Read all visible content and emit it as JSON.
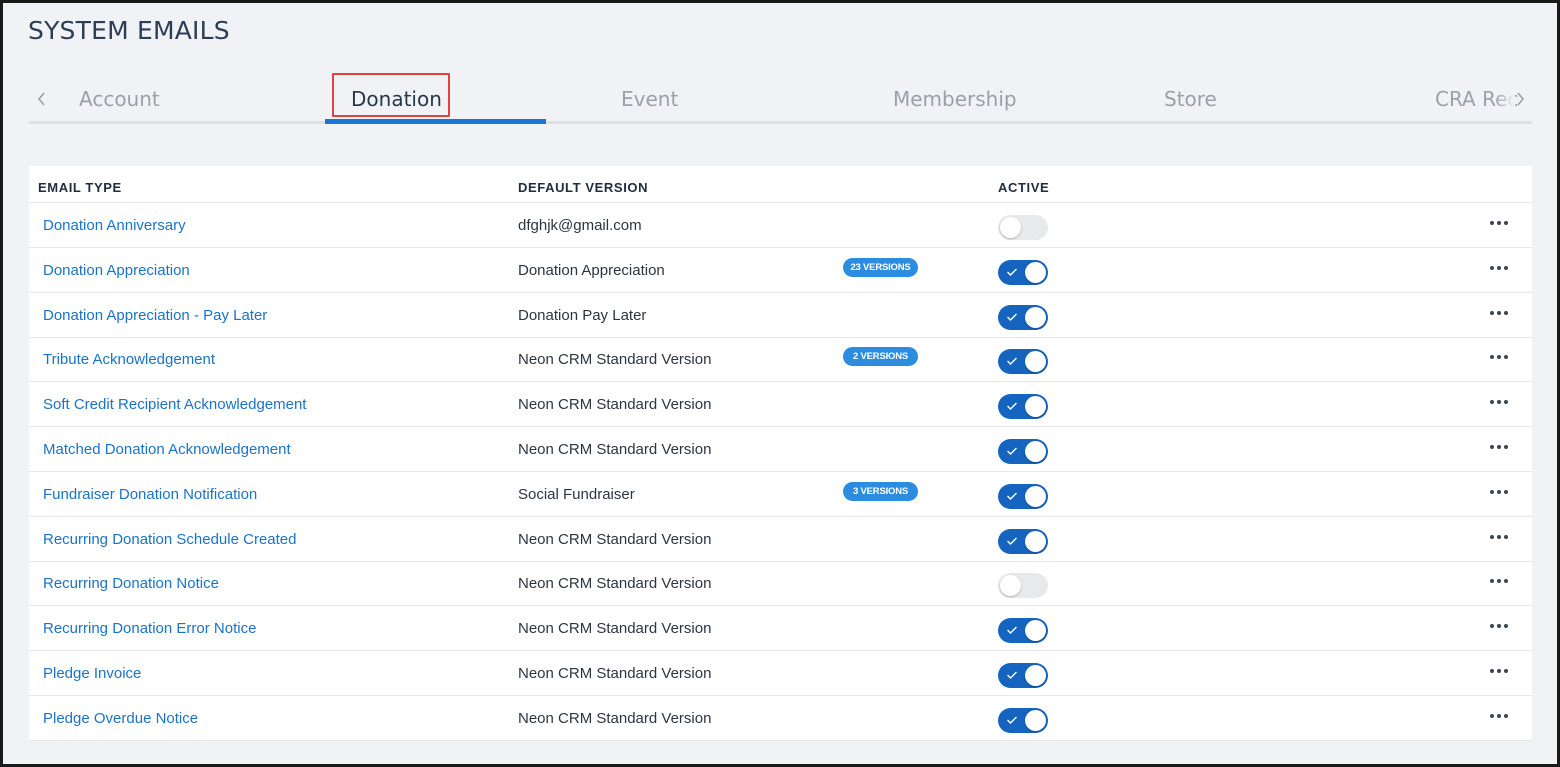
{
  "page": {
    "title": "SYSTEM EMAILS"
  },
  "tabs": [
    {
      "label": "Account",
      "active": false
    },
    {
      "label": "Donation",
      "active": true
    },
    {
      "label": "Event",
      "active": false
    },
    {
      "label": "Membership",
      "active": false
    },
    {
      "label": "Store",
      "active": false
    },
    {
      "label": "CRA Rec",
      "active": false
    }
  ],
  "table": {
    "headers": {
      "email_type": "EMAIL TYPE",
      "default_version": "DEFAULT VERSION",
      "active": "ACTIVE"
    },
    "rows": [
      {
        "email_type": "Donation Anniversary",
        "default_version": "dfghjk@gmail.com",
        "versions_badge": "",
        "active": false
      },
      {
        "email_type": "Donation Appreciation",
        "default_version": "Donation Appreciation",
        "versions_badge": "23 VERSIONS",
        "active": true
      },
      {
        "email_type": "Donation Appreciation - Pay Later",
        "default_version": "Donation Pay Later",
        "versions_badge": "",
        "active": true
      },
      {
        "email_type": "Tribute Acknowledgement",
        "default_version": "Neon CRM Standard Version",
        "versions_badge": "2 VERSIONS",
        "active": true
      },
      {
        "email_type": "Soft Credit Recipient Acknowledgement",
        "default_version": "Neon CRM Standard Version",
        "versions_badge": "",
        "active": true
      },
      {
        "email_type": "Matched Donation Acknowledgement",
        "default_version": "Neon CRM Standard Version",
        "versions_badge": "",
        "active": true
      },
      {
        "email_type": "Fundraiser Donation Notification",
        "default_version": "Social Fundraiser",
        "versions_badge": "3 VERSIONS",
        "active": true
      },
      {
        "email_type": "Recurring Donation Schedule Created",
        "default_version": "Neon CRM Standard Version",
        "versions_badge": "",
        "active": true
      },
      {
        "email_type": "Recurring Donation Notice",
        "default_version": "Neon CRM Standard Version",
        "versions_badge": "",
        "active": false
      },
      {
        "email_type": "Recurring Donation Error Notice",
        "default_version": "Neon CRM Standard Version",
        "versions_badge": "",
        "active": true
      },
      {
        "email_type": "Pledge Invoice",
        "default_version": "Neon CRM Standard Version",
        "versions_badge": "",
        "active": true
      },
      {
        "email_type": "Pledge Overdue Notice",
        "default_version": "Neon CRM Standard Version",
        "versions_badge": "",
        "active": true
      }
    ]
  },
  "icons": {
    "tab_prev": "chevron-left-icon",
    "tab_next": "chevron-right-icon",
    "toggle_check": "check-icon",
    "row_menu": "more-horizontal-icon"
  },
  "colors": {
    "link": "#1a73c7",
    "toggle_on": "#1565c0",
    "badge": "#2b8ce0",
    "tab_underline": "#1976d2",
    "highlight_box": "#e0433b"
  }
}
